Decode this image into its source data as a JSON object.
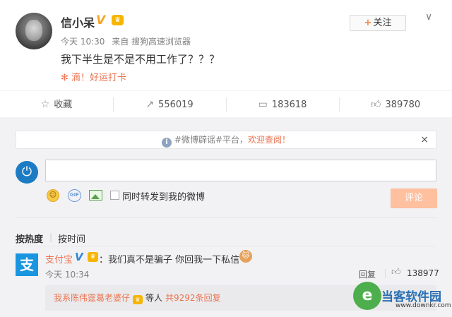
{
  "post": {
    "username": "信小呆",
    "verified_badge": "V",
    "time": "今天 10:30",
    "source": "来自 搜狗高速浏览器",
    "text": "我下半生是不是不用工作了？？？",
    "checkin": "✻ 滴！好运打卡",
    "follow_label": "关注",
    "follow_plus": "+",
    "menu_icon": "chevron-down-icon"
  },
  "actions": {
    "favorite_label": "收藏",
    "repost_count": "556019",
    "comment_count": "183618",
    "like_count": "389780"
  },
  "comment_box": {
    "notice_prefix": "#微博辟谣#平台，",
    "notice_highlight": "欢迎查阅！",
    "close_icon": "×",
    "input_value": "",
    "repost_label": "同时转发到我的微博",
    "submit_label": "评论"
  },
  "sort": {
    "hot": "按热度",
    "separator": "|",
    "time": "按时间"
  },
  "comments": [
    {
      "user": "支付宝",
      "verified_badge": "V",
      "text": "：我们真不是骗子 你回我一下私信",
      "time": "今天 10:34",
      "reply_label": "回复",
      "like_count": "138977",
      "sub_reply": {
        "user": "我系陈伟霆葛老婆仔",
        "etc": "等人",
        "count_text": "共9292条回复"
      }
    }
  ],
  "watermark": {
    "name": "当客软件园",
    "url": "www.downkr.com"
  },
  "colors": {
    "accent": "#eb7350",
    "background": "#f2f2f5",
    "submit_disabled": "#ffc09f",
    "alipay_blue": "#1a95e0"
  }
}
